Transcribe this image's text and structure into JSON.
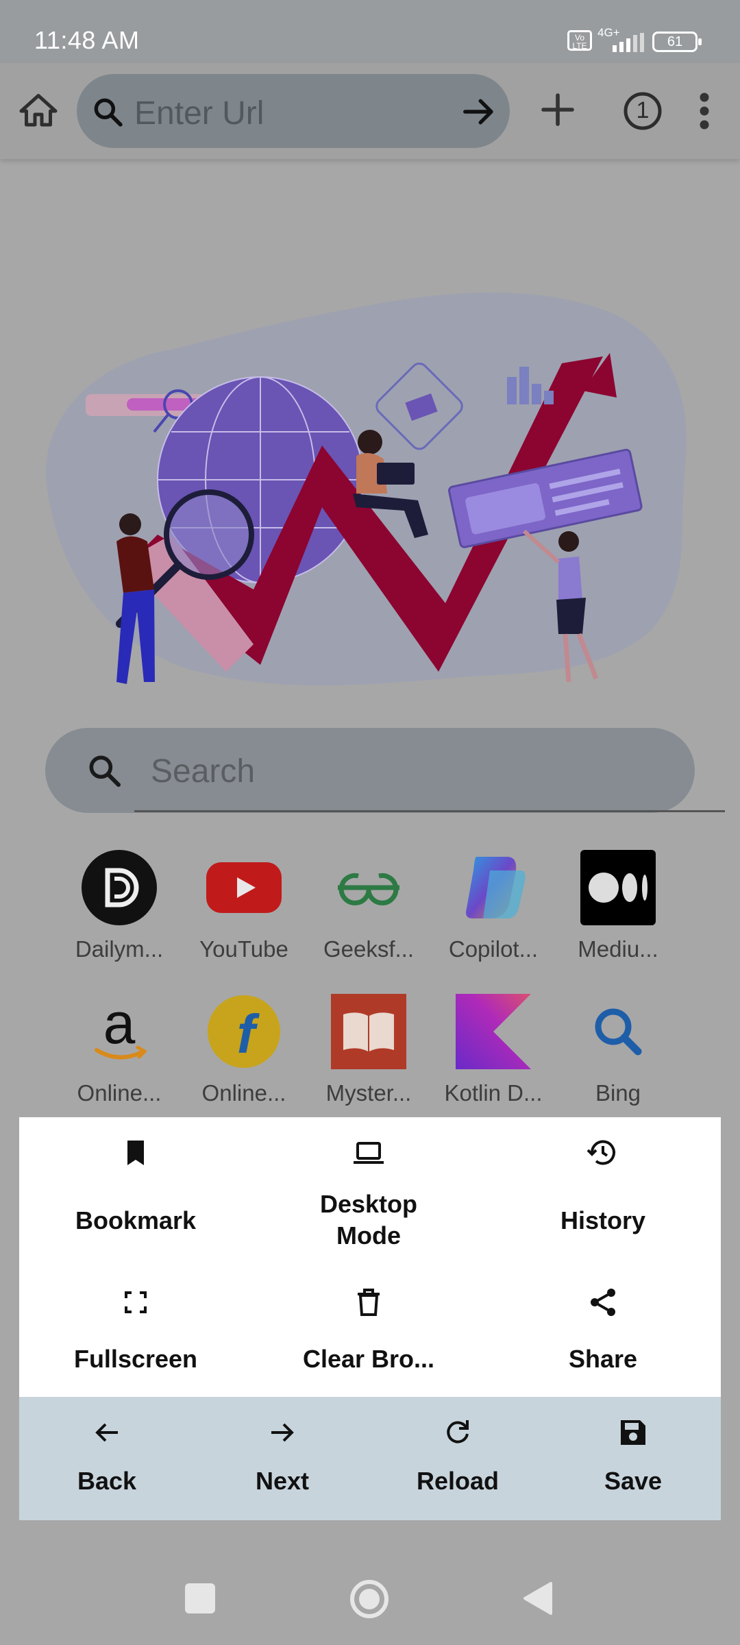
{
  "status_bar": {
    "time": "11:48 AM",
    "volte": "Vo LTE",
    "network": "4G+",
    "battery": "61"
  },
  "toolbar": {
    "url_placeholder": "Enter Url",
    "tab_count": "1"
  },
  "search": {
    "placeholder": "Search"
  },
  "shortcuts": [
    {
      "label": "Dailym...",
      "icon": "dailymotion-logo"
    },
    {
      "label": "YouTube",
      "icon": "youtube-logo"
    },
    {
      "label": "Geeksf...",
      "icon": "geeksforgeeks-logo"
    },
    {
      "label": "Copilot...",
      "icon": "copilot-logo"
    },
    {
      "label": "Mediu...",
      "icon": "medium-logo"
    },
    {
      "label": "Online...",
      "icon": "amazon-logo"
    },
    {
      "label": "Online...",
      "icon": "flipkart-logo"
    },
    {
      "label": "Myster...",
      "icon": "book-logo"
    },
    {
      "label": "Kotlin D...",
      "icon": "kotlin-logo"
    },
    {
      "label": "Bing",
      "icon": "search-logo"
    }
  ],
  "menu": {
    "bookmark": "Bookmark",
    "desktop_mode": "Desktop Mode",
    "history": "History",
    "fullscreen": "Fullscreen",
    "clear_browsing": "Clear Bro...",
    "share": "Share",
    "back": "Back",
    "next": "Next",
    "reload": "Reload",
    "save": "Save"
  },
  "colors": {
    "menu_background": "#ffffff",
    "menu_bottom_background": "#c8d4dc",
    "accent_red": "#8c0430",
    "illustration_purple": "#6a54b4"
  }
}
